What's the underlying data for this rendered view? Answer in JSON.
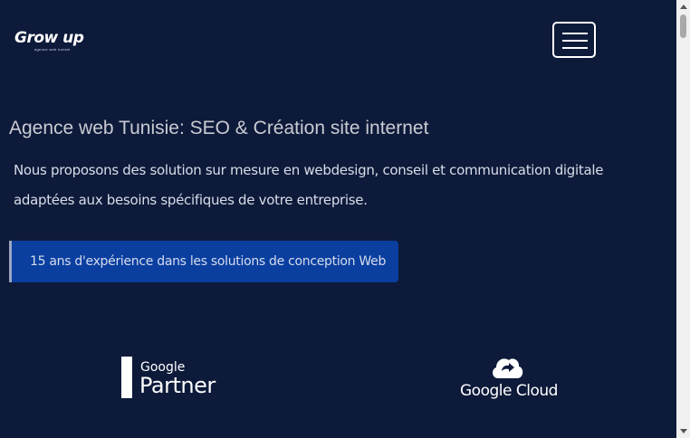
{
  "header": {
    "logo_text": "Grow up",
    "logo_tagline": "agence web tunisie",
    "menu_icon": "hamburger-icon"
  },
  "hero": {
    "title": "Agence web Tunisie: SEO & Création site internet",
    "intro": "Nous proposons des solution sur mesure en webdesign, conseil et communication digitale adaptées aux besoins spécifiques de votre entreprise.",
    "cta_label": "15 ans d'expérience dans les solutions de conception Web"
  },
  "partners": {
    "google_partner_small": "Google",
    "google_partner_big": "Partner",
    "google_cloud_label": "Google Cloud",
    "google_cloud_icon": "cloud-icon"
  },
  "colors": {
    "background": "#0d1a3a",
    "cta_background": "#0a3fa0",
    "text": "#d8dde8"
  }
}
